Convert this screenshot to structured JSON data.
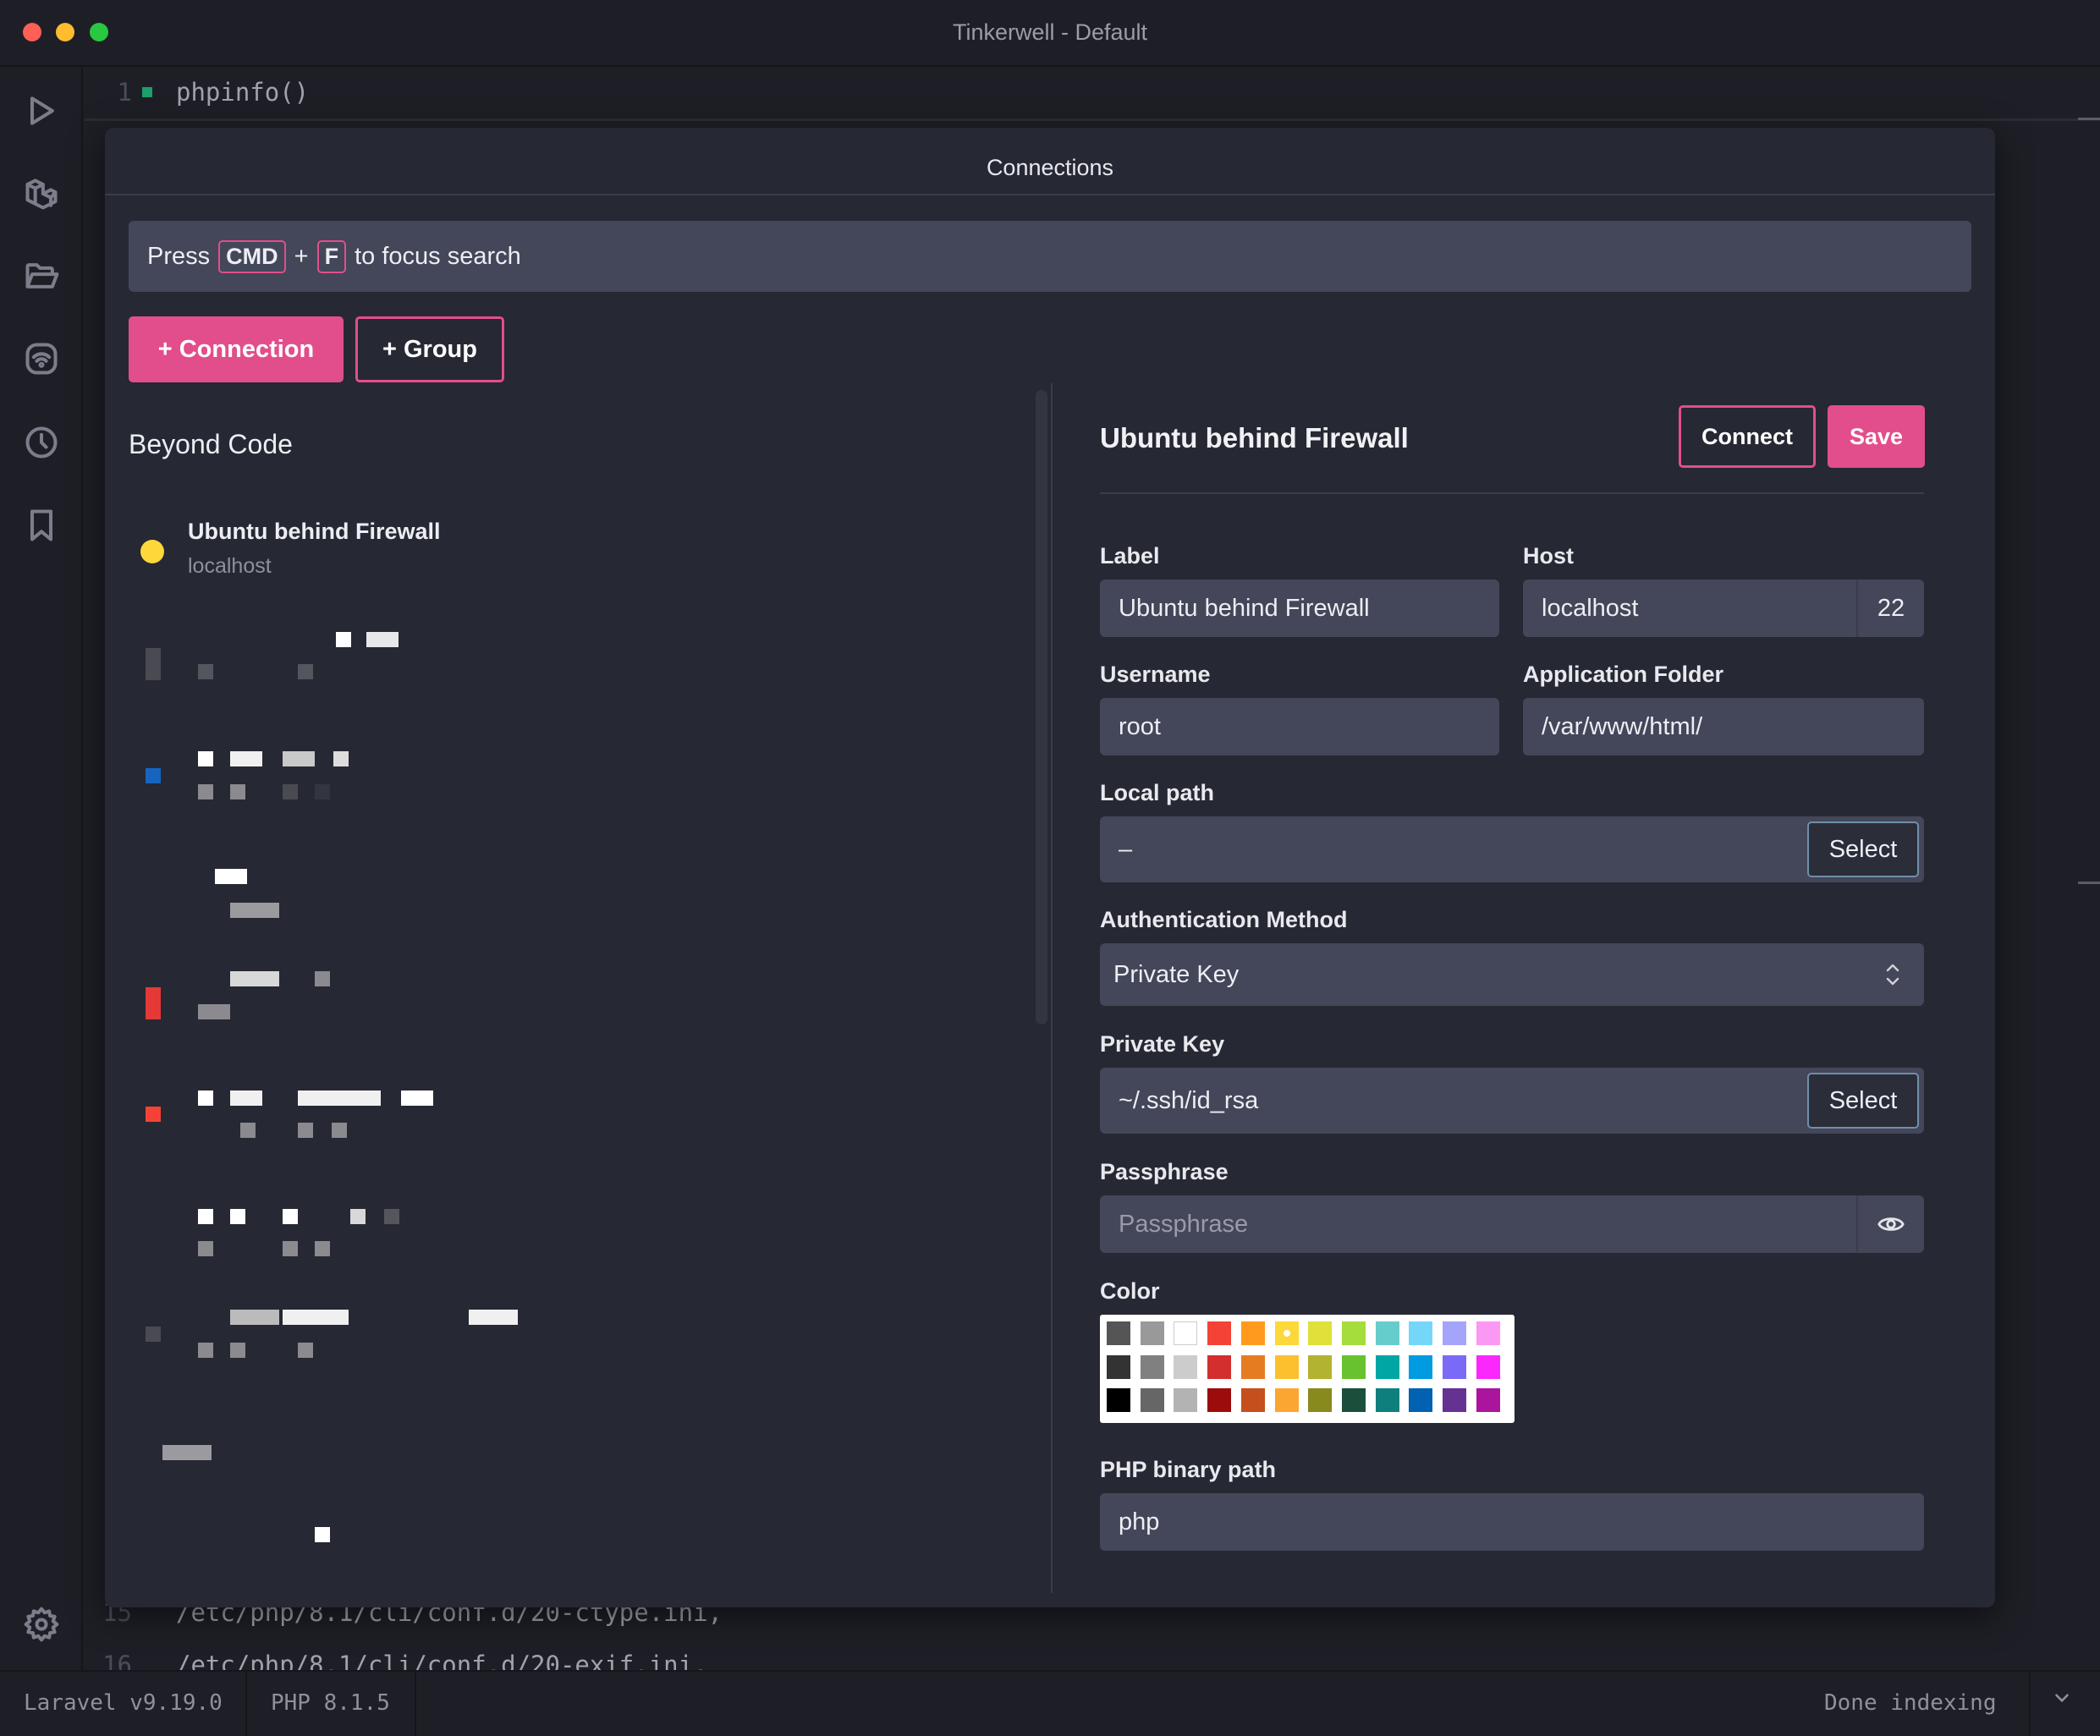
{
  "window": {
    "title": "Tinkerwell - Default"
  },
  "editor": {
    "lines": [
      {
        "num": "1",
        "code": "phpinfo()"
      },
      {
        "num": "15",
        "code": "/etc/php/8.1/cli/conf.d/20-ctype.ini,"
      },
      {
        "num": "16",
        "code": "/etc/php/8.1/cli/conf.d/20-exif.ini,"
      }
    ]
  },
  "status": {
    "laravel": "Laravel v9.19.0",
    "php": "PHP 8.1.5",
    "indexing": "Done indexing"
  },
  "modal": {
    "title": "Connections",
    "search": {
      "press": "Press",
      "key1": "CMD",
      "plus": "+",
      "key2": "F",
      "suffix": "to focus search"
    },
    "add_connection": "+ Connection",
    "add_group": "+ Group",
    "group_name": "Beyond Code",
    "selected_connection": {
      "name": "Ubuntu behind Firewall",
      "host": "localhost",
      "color": "#fcd83a"
    }
  },
  "form": {
    "title": "Ubuntu behind Firewall",
    "connect": "Connect",
    "save": "Save",
    "label_label": "Label",
    "label_value": "Ubuntu behind Firewall",
    "host_label": "Host",
    "host_value": "localhost",
    "port_value": "22",
    "username_label": "Username",
    "username_value": "root",
    "appfolder_label": "Application Folder",
    "appfolder_value": "/var/www/html/",
    "localpath_label": "Local path",
    "localpath_value": "–",
    "select": "Select",
    "auth_label": "Authentication Method",
    "auth_value": "Private Key",
    "privkey_label": "Private Key",
    "privkey_value": "~/.ssh/id_rsa",
    "passphrase_label": "Passphrase",
    "passphrase_placeholder": "Passphrase",
    "color_label": "Color",
    "php_label": "PHP binary path",
    "php_value": "php"
  },
  "palette": [
    [
      "#555555",
      "#999999",
      "#ffffff",
      "#f44336",
      "#ff9a1f",
      "#fcd83a",
      "#dfe03a",
      "#a4dd3c",
      "#66cccc",
      "#74d7fa",
      "#a4a5fa",
      "#fb98f3"
    ],
    [
      "#333333",
      "#808080",
      "#cccccc",
      "#d32f2f",
      "#e67c22",
      "#fcc02e",
      "#b2b330",
      "#67c22e",
      "#00a6a3",
      "#009be0",
      "#7a6af5",
      "#fa28fc"
    ],
    [
      "#000000",
      "#666666",
      "#b3b3b3",
      "#9d0c0c",
      "#c5501d",
      "#fba632",
      "#888a1e",
      "#1c4f3b",
      "#0f7f7d",
      "#0062b1",
      "#653294",
      "#ab159d"
    ]
  ],
  "palette_selected": "#fcd83a"
}
